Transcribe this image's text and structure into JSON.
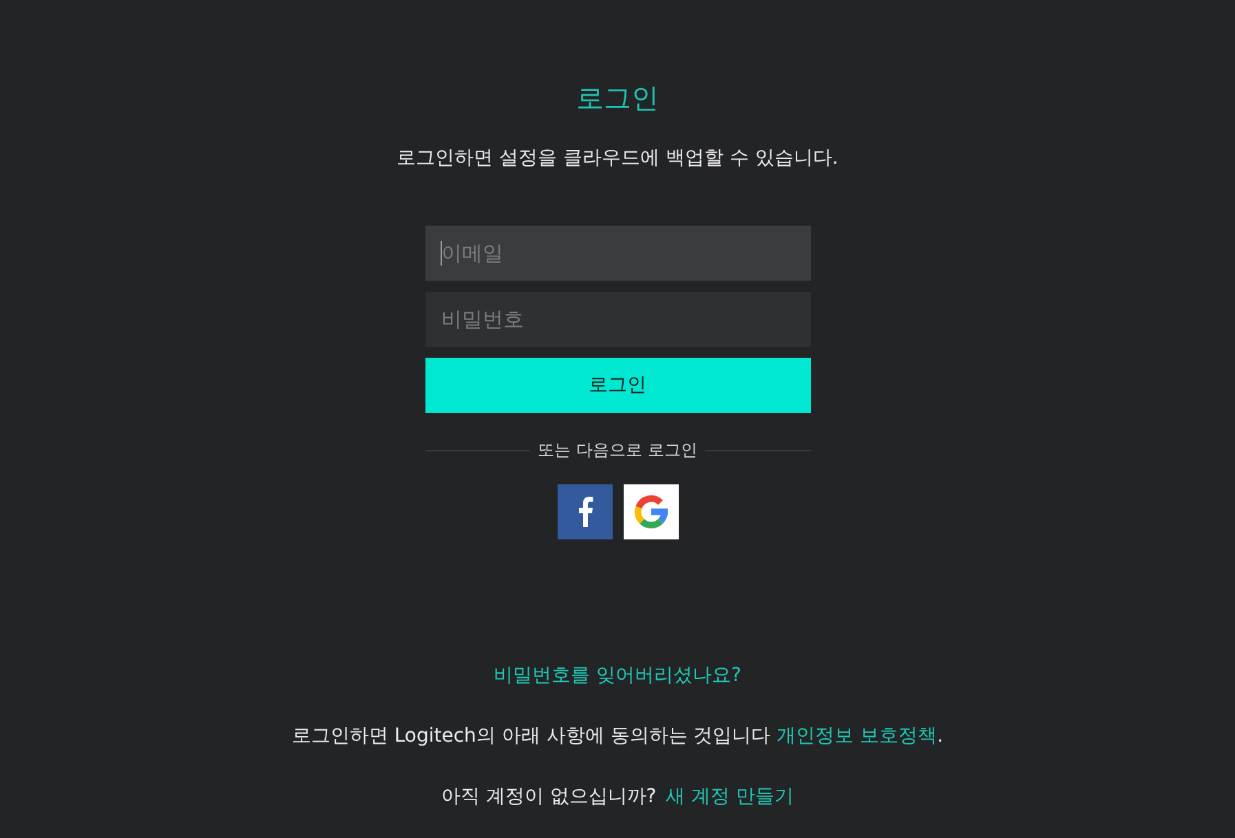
{
  "title": "로그인",
  "subtitle": "로그인하면 설정을 클라우드에 백업할 수 있습니다.",
  "form": {
    "email": {
      "placeholder": "이메일",
      "focused": true
    },
    "password": {
      "placeholder": "비밀번호",
      "focused": false
    },
    "submit": "로그인"
  },
  "divider": "또는 다음으로 로그인",
  "social_buttons": [
    {
      "kind": "facebook"
    },
    {
      "kind": "google"
    }
  ],
  "forgot_link": "비밀번호를 잊어버리셨나요?",
  "terms": {
    "text": "로그인하면 Logitech의 아래 사항에 동의하는 것입니다",
    "link": "개인정보 보호정책",
    "end": "."
  },
  "signup": {
    "text": "아직 계정이 없으십니까?",
    "link": "새 계정 만들기"
  }
}
